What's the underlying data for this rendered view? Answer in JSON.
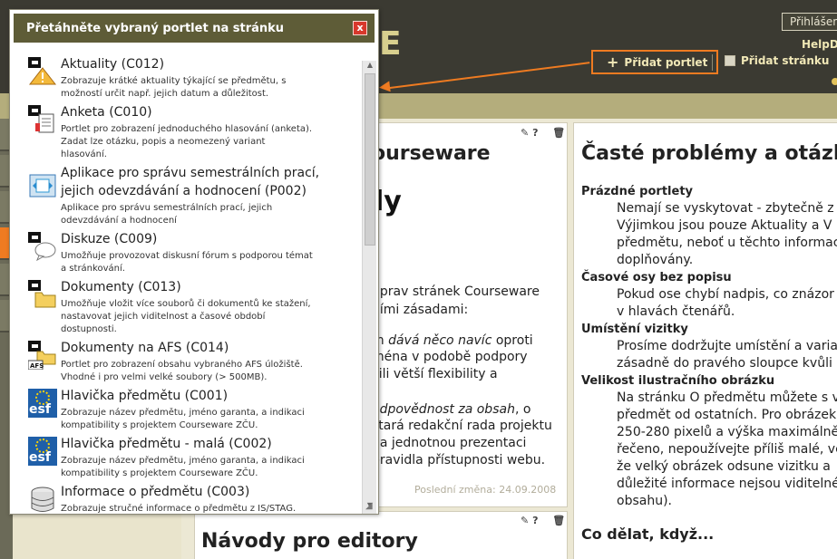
{
  "header": {
    "logo_letter": "E",
    "login_label": "Přihlášen",
    "help_label": "HelpD",
    "add_portlet_label": "Přidat portlet",
    "add_page_label": "Přidat stránku"
  },
  "popup": {
    "title": "Přetáhněte vybraný portlet na stránku",
    "close_label": "x",
    "items": [
      {
        "name": "Aktuality (C012)",
        "desc1": "Zobrazuje krátké aktuality týkající se předmětu, s",
        "desc2": "možností určit např. jejich datum a důležitost.",
        "desc3": "",
        "icon": "news-warning-icon"
      },
      {
        "name": "Anketa (C010)",
        "desc1": "Portlet pro zobrazení jednoduchého hlasování (anketa).",
        "desc2": "Zadat lze otázku, popis a neomezený variant",
        "desc3": "hlasování.",
        "icon": "poll-list-icon"
      },
      {
        "name": "Aplikace pro správu semestrálních prací,",
        "name2": "jejich odevzdávání a hodnocení (P002)",
        "desc1": "Aplikace pro správu semestrálních prací, jejich",
        "desc2": "odevzdávání a hodnocení",
        "desc3": "",
        "icon": "assignment-app-icon"
      },
      {
        "name": "Diskuze (C009)",
        "desc1": "Umožňuje provozovat diskusní fórum s podporou témat",
        "desc2": "a stránkování.",
        "desc3": "",
        "icon": "discussion-icon"
      },
      {
        "name": "Dokumenty (C013)",
        "desc1": "Umožňuje vložit více souborů či dokumentů ke stažení,",
        "desc2": "nastavovat jejich viditelnost a časové období",
        "desc3": "dostupnosti.",
        "icon": "folder-icon"
      },
      {
        "name": "Dokumenty na AFS (C014)",
        "desc1": "Portlet pro zobrazení obsahu vybraného AFS úložiště.",
        "desc2": "Vhodné i pro velmi velké soubory (> 500MB).",
        "desc3": "",
        "icon": "afs-folder-icon"
      },
      {
        "name": "Hlavička předmětu (C001)",
        "desc1": "Zobrazuje název předmětu, jméno garanta, a indikaci",
        "desc2": "kompatibility s projektem Courseware ZČU.",
        "desc3": "",
        "icon": "esf-logo-icon"
      },
      {
        "name": "Hlavička předmětu - malá (C002)",
        "desc1": "Zobrazuje název předmětu, jméno garanta, a indikaci",
        "desc2": "kompatibility s projektem Courseware ZČU.",
        "desc3": "",
        "icon": "esf-logo-icon"
      },
      {
        "name": "Informace o předmětu (C003)",
        "desc1": "Zobrazuje stručné informace o předmětu z IS/STAG.",
        "desc2": "",
        "desc3": "",
        "icon": "database-icon"
      }
    ]
  },
  "mid_panel": {
    "heading": "ourseware",
    "heading2": "ly",
    "lines": [
      "úprav stránek Courseware",
      "ními zásadami:"
    ],
    "para2_a": "m ",
    "para2_italic": "dává něco navíc",
    "para2_b": " oproti",
    "para2_lines": [
      "ména v podobě podpory",
      "čili větší flexibility a"
    ],
    "para3_italic": "odpovědnost za obsah",
    "para3_b": ", o",
    "para3_lines": [
      "stará redakční rada projektu",
      "na jednotnou prezentaci",
      "pravidla přístupnosti webu."
    ],
    "last_change": "Poslední změna: 24.09.2008",
    "panel2_heading": "Návody pro editory"
  },
  "right_panel": {
    "heading": "Časté problémy a otázk",
    "sections": [
      {
        "title": "Prázdné portlety",
        "lines": [
          "Nemají se vyskytovat - zbytečně z",
          "Výjimkou jsou pouze Aktuality a V",
          "předmětu, neboť u těchto informac",
          "doplňovány."
        ]
      },
      {
        "title": "Časové osy bez popisu",
        "lines": [
          "Pokud ose chybí nadpis, co znázor",
          "v hlavách čtenářů."
        ]
      },
      {
        "title": "Umístění vizitky",
        "lines": [
          "Prosíme dodržujte umístění a varia",
          "zásadně do pravého sloupce kvůli"
        ]
      },
      {
        "title": "Velikost ilustračního obrázku",
        "lines": [
          "Na stránku O předmětu můžete s v",
          "předmět od ostatních. Pro obrázek",
          "250-280 pixelů a výška maximálně",
          "řečeno, nepoužívejte příliš malé, ve",
          "že velký obrázek odsune vizitku a",
          "důležité informace nejsou viditelné",
          "obsahu)."
        ]
      }
    ],
    "heading2": "Co dělat, když..."
  },
  "colors": {
    "header_bg": "#3b3a32",
    "accent_orange": "#ef7b21",
    "popup_header": "#5e5c37",
    "strip": "#b4ad7c"
  }
}
